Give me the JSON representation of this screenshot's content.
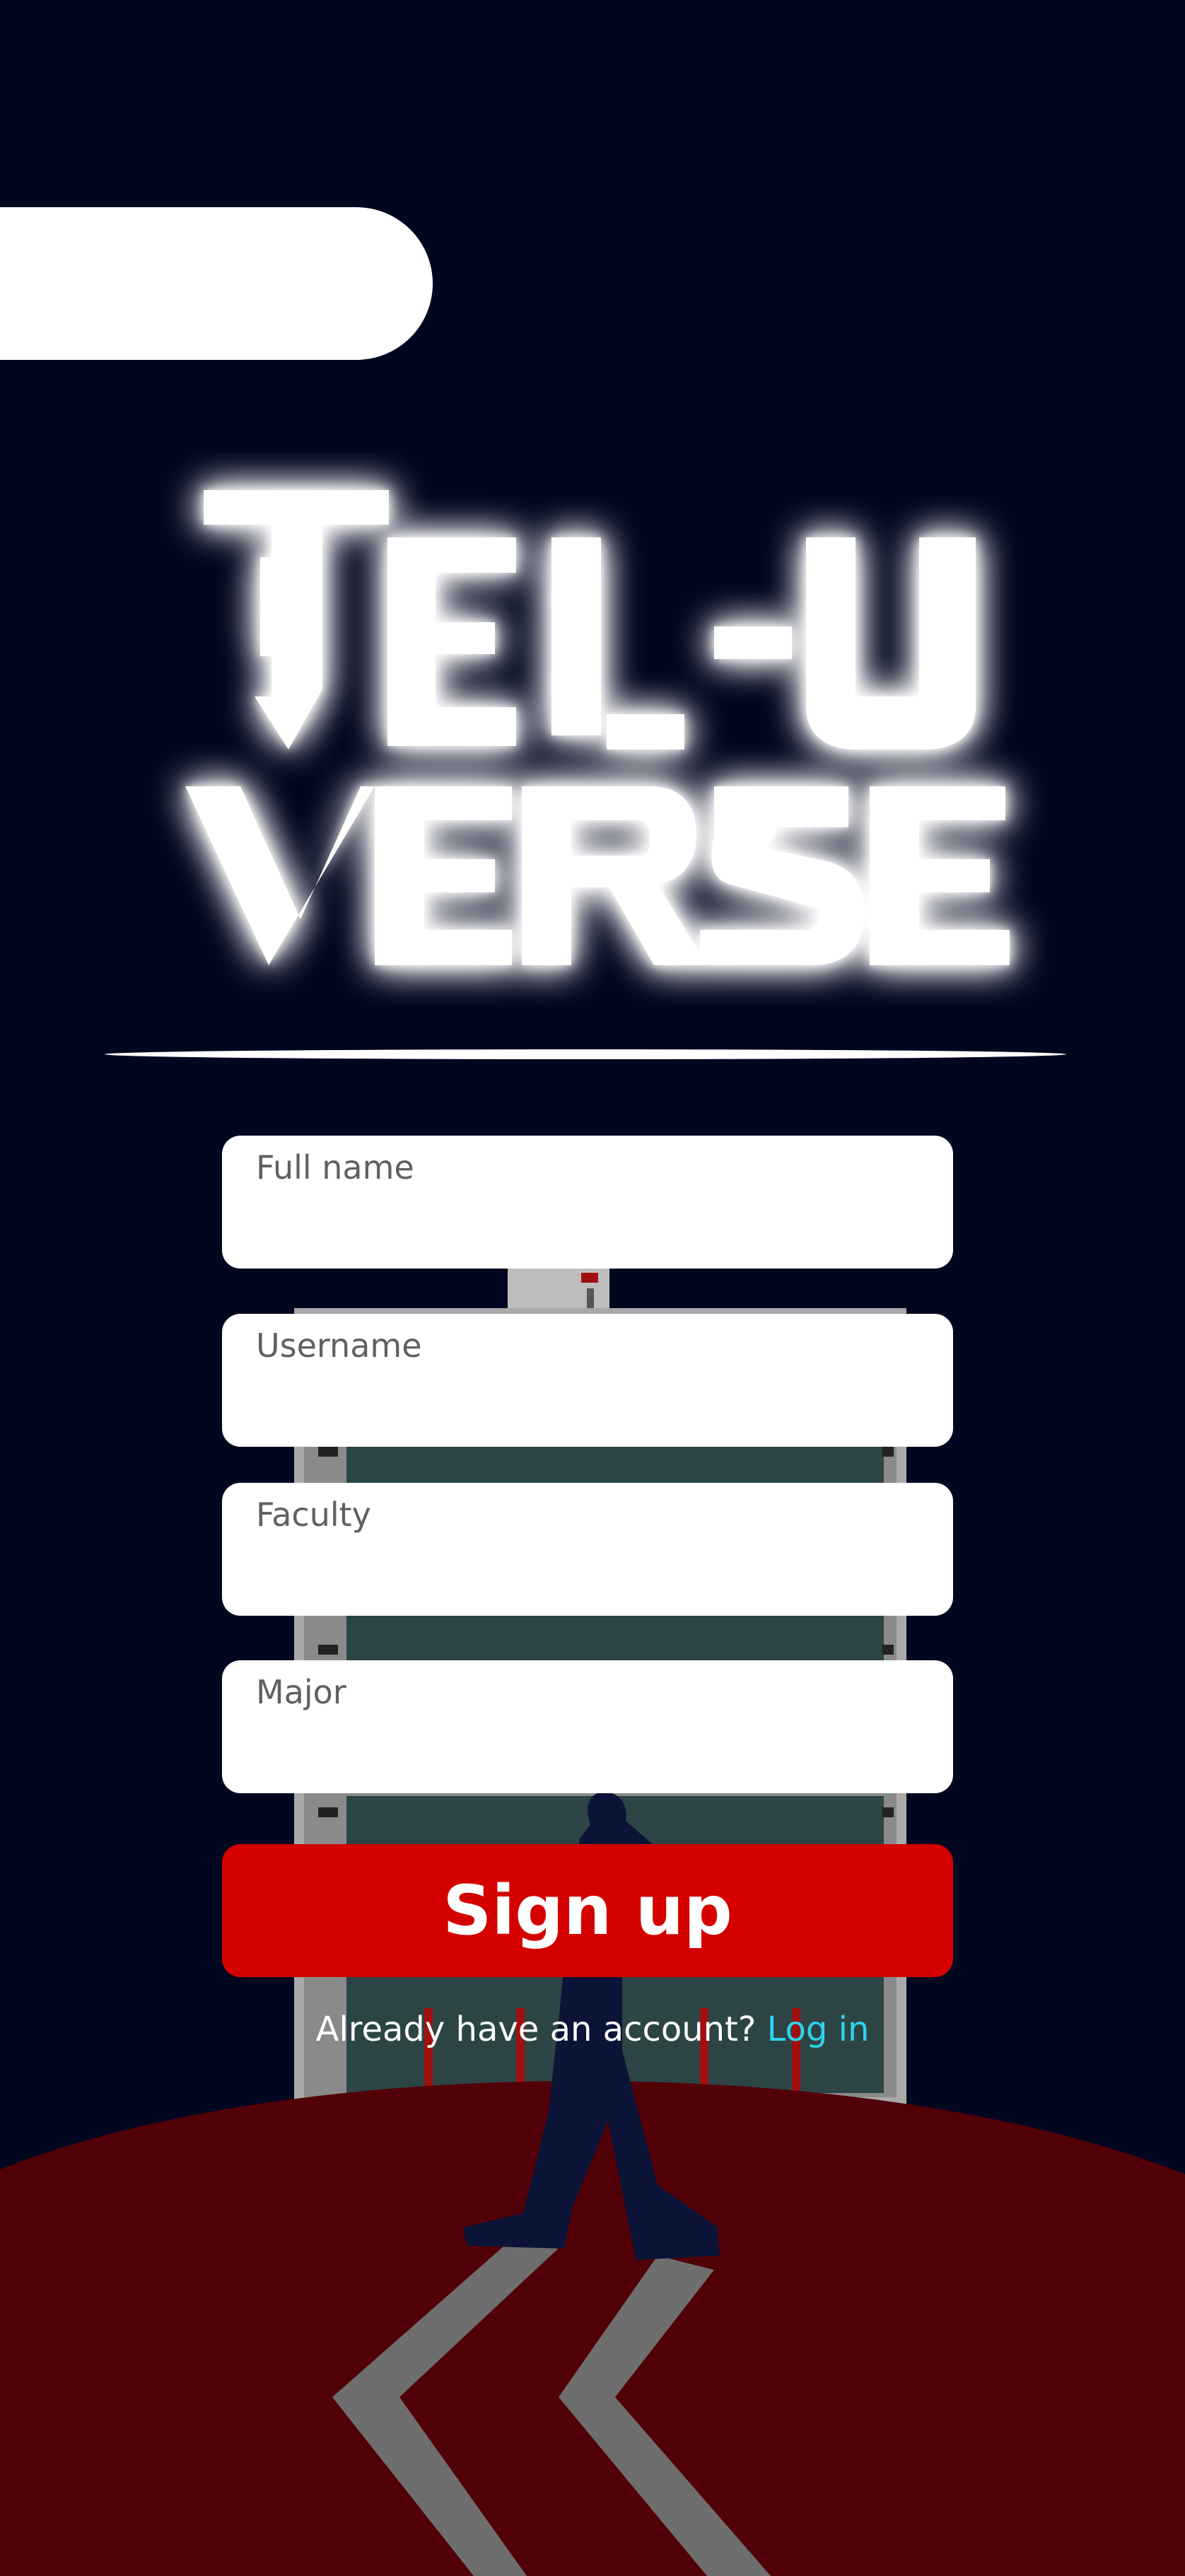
{
  "app": {
    "logo_line1": "TEL-U",
    "logo_line2": "VERSE"
  },
  "form": {
    "fields": [
      {
        "placeholder": "Full name",
        "value": ""
      },
      {
        "placeholder": "Username",
        "value": ""
      },
      {
        "placeholder": "Faculty",
        "value": ""
      },
      {
        "placeholder": "Major",
        "value": ""
      }
    ],
    "submit_label": "Sign up"
  },
  "footer": {
    "prompt": "Already have an account?",
    "login_link": "Log in"
  },
  "colors": {
    "background": "#020720",
    "accent": "#d40000",
    "link": "#2fd3ee",
    "ground": "#520008"
  }
}
